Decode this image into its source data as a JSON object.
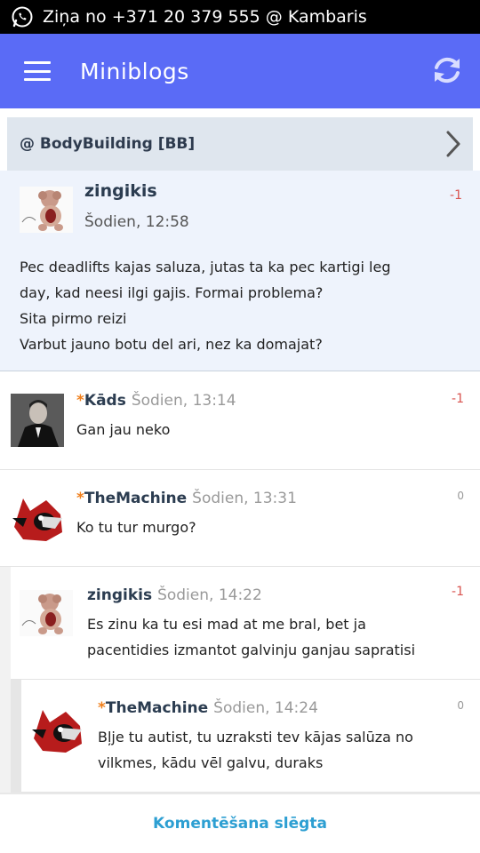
{
  "status_bar": {
    "text": "Ziņa no +371 20 379 555 @ Kambaris"
  },
  "app_bar": {
    "title": "Miniblogs"
  },
  "group": {
    "name": "@ BodyBuilding [BB]"
  },
  "post": {
    "author": "zingikis",
    "time": "Šodien, 12:58",
    "score": "-1",
    "lines": [
      "Pec deadlifts kajas saluza, jutas ta ka pec kartigi leg",
      "day, kad neesi ilgi gajis. Formai problema?",
      "Sita pirmo reizi",
      "Varbut jauno botu del ari, nez ka domajat?"
    ]
  },
  "comments": [
    {
      "star": "*",
      "author": "Kāds",
      "time": "Šodien, 13:14",
      "score": "-1",
      "lines": [
        "Gan jau neko"
      ]
    },
    {
      "star": "*",
      "author": "TheMachine",
      "time": "Šodien, 13:31",
      "score": "0",
      "lines": [
        "Ko tu tur murgo?"
      ]
    },
    {
      "star": "",
      "author": "zingikis",
      "time": "Šodien, 14:22",
      "score": "-1",
      "lines": [
        "Es zinu ka tu esi mad at me bral, bet ja",
        "pacentidies izmantot galvinju ganjau sapratisi"
      ]
    },
    {
      "star": "*",
      "author": "TheMachine",
      "time": "Šodien, 14:24",
      "score": "0",
      "lines": [
        "Bļje tu autist, tu uzraksti tev kājas salūza no",
        "vilkmes, kādu vēl galvu, duraks"
      ]
    }
  ],
  "footer": {
    "label": "Komentēšana slēgta"
  },
  "colors": {
    "app_bar": "#5a6bf6",
    "negative_score": "#d9534f",
    "star": "#f07f1b",
    "footer_link": "#2d9fd2"
  }
}
